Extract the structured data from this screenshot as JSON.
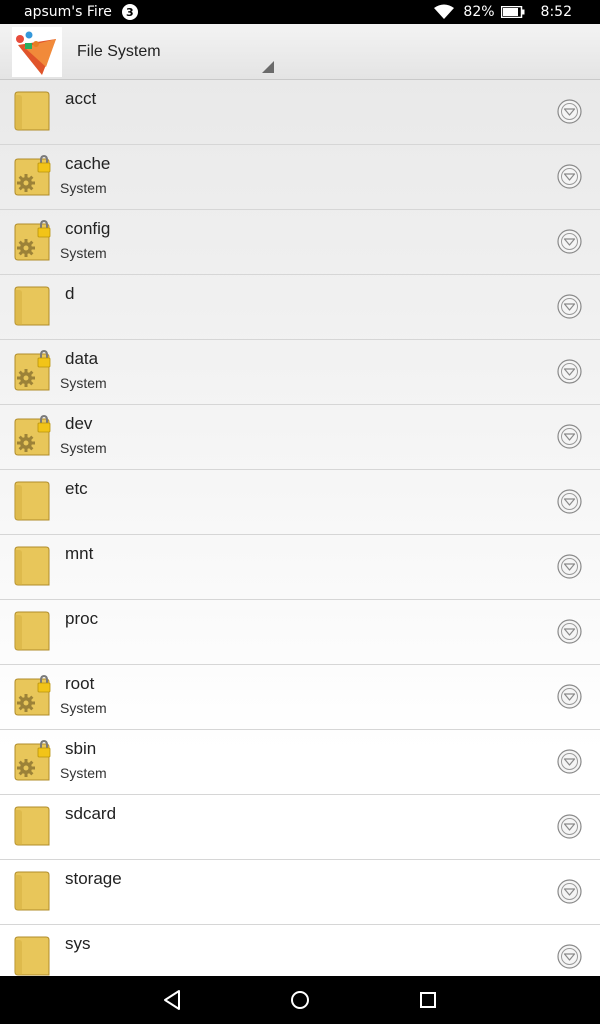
{
  "status_bar": {
    "title": "apsum's Fire",
    "notification_count": "3",
    "battery": "82%",
    "time": "8:52"
  },
  "app_bar": {
    "title": "File System"
  },
  "files": [
    {
      "name": "acct",
      "sub": "",
      "locked": false
    },
    {
      "name": "cache",
      "sub": "System",
      "locked": true
    },
    {
      "name": "config",
      "sub": "System",
      "locked": true
    },
    {
      "name": "d",
      "sub": "",
      "locked": false
    },
    {
      "name": "data",
      "sub": "System",
      "locked": true
    },
    {
      "name": "dev",
      "sub": "System",
      "locked": true
    },
    {
      "name": "etc",
      "sub": "",
      "locked": false
    },
    {
      "name": "mnt",
      "sub": "",
      "locked": false
    },
    {
      "name": "proc",
      "sub": "",
      "locked": false
    },
    {
      "name": "root",
      "sub": "System",
      "locked": true
    },
    {
      "name": "sbin",
      "sub": "System",
      "locked": true
    },
    {
      "name": "sdcard",
      "sub": "",
      "locked": false
    },
    {
      "name": "storage",
      "sub": "",
      "locked": false
    },
    {
      "name": "sys",
      "sub": "",
      "locked": false
    }
  ],
  "icons": {
    "folder": "folder-icon",
    "system_folder": "system-folder-lock-icon",
    "row_menu": "chevron-down-circle-icon"
  },
  "colors": {
    "folder": "#e8c65a",
    "status_bar": "#000000",
    "nav_bar": "#000000"
  }
}
